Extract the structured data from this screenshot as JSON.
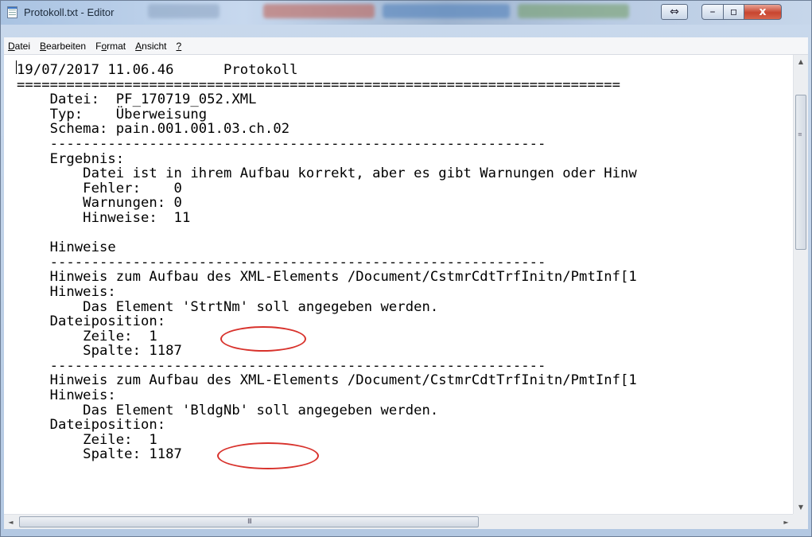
{
  "window": {
    "title": "Protokoll.txt - Editor",
    "controls": {
      "snap": "⇔",
      "minimize": "–",
      "maximize": "▫",
      "close": "x"
    }
  },
  "menu": [
    {
      "label": "Datei",
      "accel": "D"
    },
    {
      "label": "Bearbeiten",
      "accel": "B"
    },
    {
      "label": "Format",
      "accel": "o"
    },
    {
      "label": "Ansicht",
      "accel": "A"
    },
    {
      "label": "?",
      "accel": "?"
    }
  ],
  "document": {
    "lines": [
      "19/07/2017 11.06.46      Protokoll",
      "=========================================================================",
      "    Datei:  PF_170719_052.XML",
      "    Typ:    Überweisung",
      "    Schema: pain.001.001.03.ch.02",
      "    ------------------------------------------------------------",
      "    Ergebnis:",
      "        Datei ist in ihrem Aufbau korrekt, aber es gibt Warnungen oder Hinw",
      "        Fehler:    0",
      "        Warnungen: 0",
      "        Hinweise:  11",
      "",
      "    Hinweise",
      "    ------------------------------------------------------------",
      "    Hinweis zum Aufbau des XML-Elements /Document/CstmrCdtTrfInitn/PmtInf[1",
      "    Hinweis:",
      "        Das Element 'StrtNm' soll angegeben werden.",
      "    Dateiposition:",
      "        Zeile:  1",
      "        Spalte: 1187",
      "    ------------------------------------------------------------",
      "    Hinweis zum Aufbau des XML-Elements /Document/CstmrCdtTrfInitn/PmtInf[1",
      "    Hinweis:",
      "        Das Element 'BldgNb' soll angegeben werden.",
      "    Dateiposition:",
      "        Zeile:  1",
      "        Spalte: 1187"
    ]
  },
  "scrollbars": {
    "vertical": {
      "up": "▲",
      "down": "▼",
      "grip": "≡"
    },
    "horizontal": {
      "left": "◄",
      "right": "►",
      "grip": "III"
    }
  },
  "annotations": {
    "color": "#d8322c",
    "highlighted": [
      "'StrtNm'",
      "'BldgNb'"
    ]
  }
}
